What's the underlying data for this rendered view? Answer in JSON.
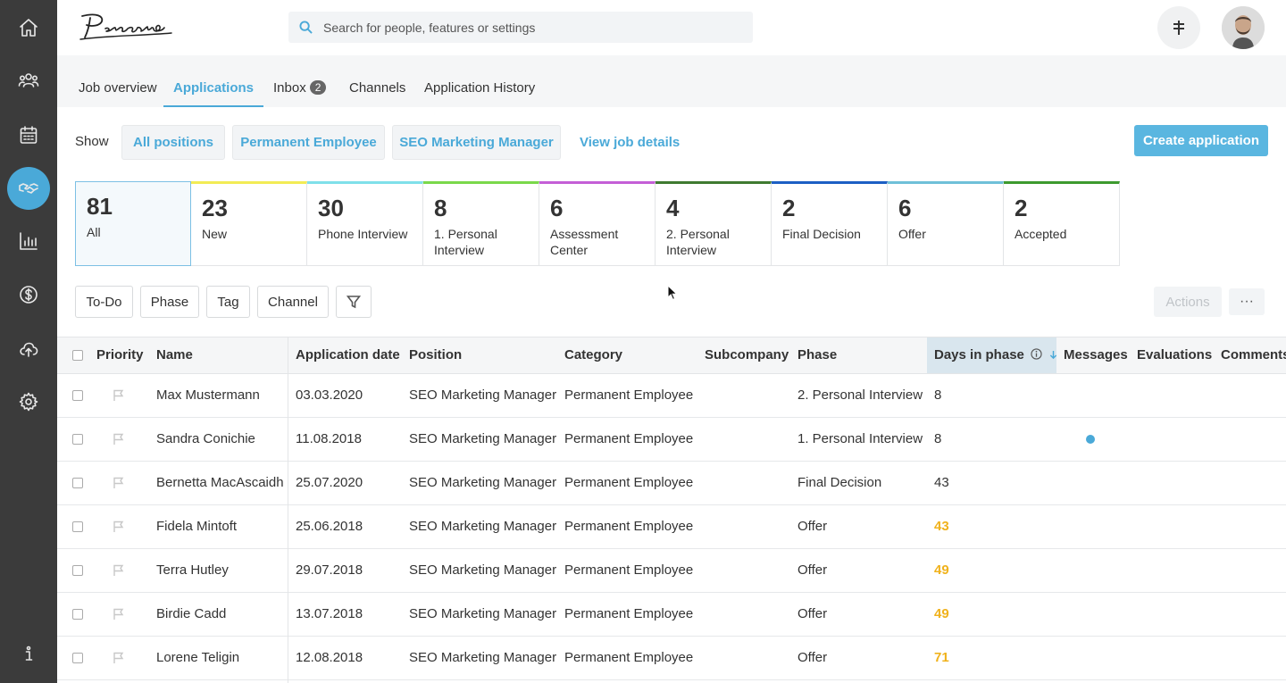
{
  "header": {
    "logo_text": "Personio",
    "search_placeholder": "Search for people, features or settings"
  },
  "tabs": [
    {
      "label": "Job overview"
    },
    {
      "label": "Applications",
      "active": true
    },
    {
      "label": "Inbox",
      "badge": "2"
    },
    {
      "label": "Channels"
    },
    {
      "label": "Application History"
    }
  ],
  "show": {
    "label": "Show",
    "chips": [
      "All positions",
      "Permanent Employee",
      "SEO Marketing Manager"
    ],
    "link": "View job details",
    "create_button": "Create application"
  },
  "phases": [
    {
      "count": "81",
      "label": "All",
      "color": "#7cc0e4"
    },
    {
      "count": "23",
      "label": "New",
      "color": "#f2ec55"
    },
    {
      "count": "30",
      "label": "Phone Interview",
      "color": "#7fe0ea"
    },
    {
      "count": "8",
      "label": "1. Personal Interview",
      "color": "#7ad84a"
    },
    {
      "count": "6",
      "label": "Assessment Center",
      "color": "#c45fd6"
    },
    {
      "count": "4",
      "label": "2. Personal Interview",
      "color": "#3f7a30"
    },
    {
      "count": "2",
      "label": "Final Decision",
      "color": "#1c5fc4"
    },
    {
      "count": "6",
      "label": "Offer",
      "color": "#6fc0d8"
    },
    {
      "count": "2",
      "label": "Accepted",
      "color": "#3d9a2e"
    }
  ],
  "filters": {
    "todo": "To-Do",
    "phase": "Phase",
    "tag": "Tag",
    "channel": "Channel",
    "actions": "Actions",
    "more": "···"
  },
  "table": {
    "columns": {
      "priority": "Priority",
      "name": "Name",
      "application_date": "Application date",
      "position": "Position",
      "category": "Category",
      "subcompany": "Subcompany",
      "phase": "Phase",
      "days_in_phase": "Days in phase",
      "messages": "Messages",
      "evaluations": "Evaluations",
      "comments": "Comments"
    },
    "rows": [
      {
        "name": "Max Mustermann",
        "date": "03.03.2020",
        "position": "SEO Marketing Manager",
        "category": "Permanent Employee",
        "phase": "2. Personal Interview",
        "days": "8",
        "warn": false,
        "message": false
      },
      {
        "name": "Sandra Conichie",
        "date": "11.08.2018",
        "position": "SEO Marketing Manager",
        "category": "Permanent Employee",
        "phase": "1. Personal Interview",
        "days": "8",
        "warn": false,
        "message": true
      },
      {
        "name": "Bernetta MacAscaidh",
        "date": "25.07.2020",
        "position": "SEO Marketing Manager",
        "category": "Permanent Employee",
        "phase": "Final Decision",
        "days": "43",
        "warn": false,
        "message": false
      },
      {
        "name": "Fidela Mintoft",
        "date": "25.06.2018",
        "position": "SEO Marketing Manager",
        "category": "Permanent Employee",
        "phase": "Offer",
        "days": "43",
        "warn": true,
        "message": false
      },
      {
        "name": "Terra Hutley",
        "date": "29.07.2018",
        "position": "SEO Marketing Manager",
        "category": "Permanent Employee",
        "phase": "Offer",
        "days": "49",
        "warn": true,
        "message": false
      },
      {
        "name": "Birdie Cadd",
        "date": "13.07.2018",
        "position": "SEO Marketing Manager",
        "category": "Permanent Employee",
        "phase": "Offer",
        "days": "49",
        "warn": true,
        "message": false
      },
      {
        "name": "Lorene Teligin",
        "date": "12.08.2018",
        "position": "SEO Marketing Manager",
        "category": "Permanent Employee",
        "phase": "Offer",
        "days": "71",
        "warn": true,
        "message": false
      }
    ]
  },
  "colors": {
    "accent": "#4aa9d8",
    "sidebar": "#3b3b3b",
    "warning": "#f0b21c"
  },
  "sidebar_icons": [
    "home-icon",
    "people-icon",
    "calendar-icon",
    "handshake-icon",
    "chart-icon",
    "dollar-icon",
    "cloud-upload-icon",
    "gear-icon",
    "info-icon"
  ]
}
